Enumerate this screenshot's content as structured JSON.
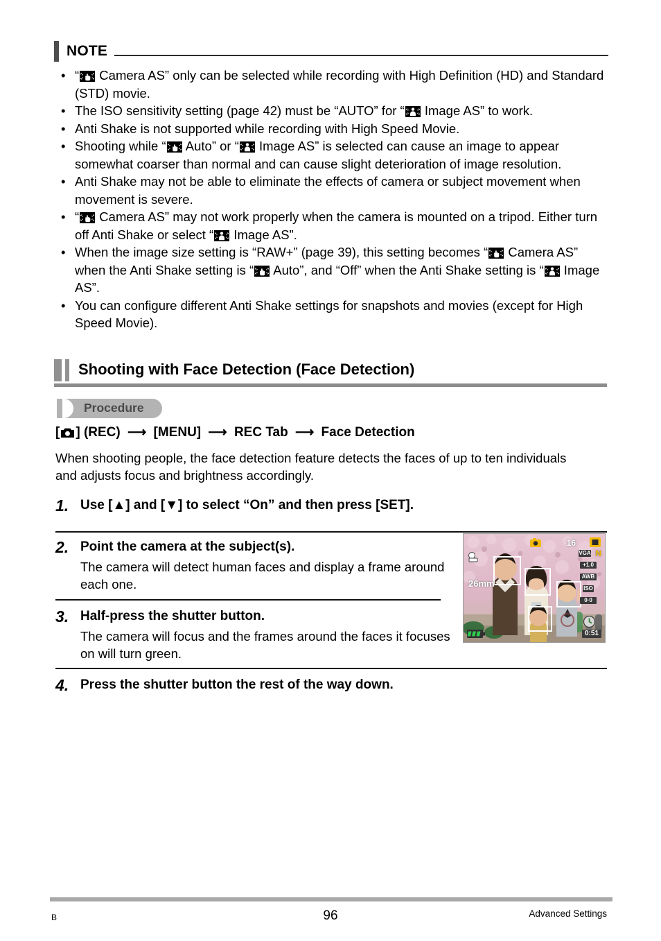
{
  "note": {
    "heading": "NOTE",
    "bullets": [
      {
        "segments": [
          {
            "t": "text",
            "v": "“"
          },
          {
            "t": "icon",
            "v": "camera-as-icon"
          },
          {
            "t": "text",
            "v": " Camera AS” only can be selected while recording with High Definition (HD) and Standard (STD) movie."
          }
        ]
      },
      {
        "segments": [
          {
            "t": "text",
            "v": "The ISO sensitivity setting (page 42) must be “AUTO” for “"
          },
          {
            "t": "icon",
            "v": "image-as-icon"
          },
          {
            "t": "text",
            "v": " Image AS” to work."
          }
        ]
      },
      {
        "segments": [
          {
            "t": "text",
            "v": "Anti Shake is not supported while recording with High Speed Movie."
          }
        ]
      },
      {
        "segments": [
          {
            "t": "text",
            "v": "Shooting while “"
          },
          {
            "t": "icon",
            "v": "camera-as-icon"
          },
          {
            "t": "text",
            "v": " Auto” or “"
          },
          {
            "t": "icon",
            "v": "image-as-icon"
          },
          {
            "t": "text",
            "v": " Image AS” is selected can cause an image to appear somewhat coarser than normal and can cause slight deterioration of image resolution."
          }
        ]
      },
      {
        "segments": [
          {
            "t": "text",
            "v": "Anti Shake may not be able to eliminate the effects of camera or subject movement when movement is severe."
          }
        ]
      },
      {
        "segments": [
          {
            "t": "text",
            "v": "“"
          },
          {
            "t": "icon",
            "v": "camera-as-icon"
          },
          {
            "t": "text",
            "v": " Camera AS” may not work properly when the camera is mounted on a tripod. Either turn off Anti Shake or select “"
          },
          {
            "t": "icon",
            "v": "image-as-icon"
          },
          {
            "t": "text",
            "v": " Image AS”."
          }
        ]
      },
      {
        "segments": [
          {
            "t": "text",
            "v": "When the image size setting is “RAW+” (page 39), this setting becomes “"
          },
          {
            "t": "icon",
            "v": "camera-as-icon"
          },
          {
            "t": "text",
            "v": " Camera AS” when the Anti Shake setting is “"
          },
          {
            "t": "icon",
            "v": "camera-as-icon"
          },
          {
            "t": "text",
            "v": " Auto”, and “Off” when the Anti Shake setting is “"
          },
          {
            "t": "icon",
            "v": "image-as-icon"
          },
          {
            "t": "text",
            "v": " Image AS”."
          }
        ]
      },
      {
        "segments": [
          {
            "t": "text",
            "v": "You can configure different Anti Shake settings for snapshots and movies (except for High Speed Movie)."
          }
        ]
      }
    ]
  },
  "section": {
    "title": "Shooting with Face Detection (Face Detection)",
    "procedure_label": "Procedure",
    "path": {
      "bracket_open": "[",
      "camera_icon": "camera-icon",
      "bracket_close": "]",
      "rec": "(REC)",
      "arrow": "⟶",
      "menu": "[MENU]",
      "rec_tab": "REC Tab",
      "face_detection": "Face Detection"
    },
    "intro": "When shooting people, the face detection feature detects the faces of up to ten individuals and adjusts focus and brightness accordingly."
  },
  "steps": [
    {
      "number": "1.",
      "title": "Use [▲] and [▼] to select “On” and then press [SET].",
      "desc": ""
    },
    {
      "number": "2.",
      "title": "Point the camera at the subject(s).",
      "desc": "The camera will detect human faces and display a frame around each one."
    },
    {
      "number": "3.",
      "title": "Half-press the shutter button.",
      "desc": "The camera will focus and the frames around the faces it focuses on will turn green."
    },
    {
      "number": "4.",
      "title": "Press the shutter button the rest of the way down.",
      "desc": ""
    }
  ],
  "lcd": {
    "focal_length": "26mm",
    "remaining_shots": "16",
    "quality": "VGA",
    "quality_n": "N",
    "osd_chips": [
      "+1.0",
      "AWB",
      "ISO",
      "0·0"
    ],
    "time_remaining": "0:51",
    "battery": "battery-full-icon",
    "rec_mode": "still-camera-icon",
    "image_size": "image-size-icon",
    "face_boxes": 4
  },
  "footer": {
    "left": "B",
    "page": "96",
    "right": "Advanced Settings"
  }
}
